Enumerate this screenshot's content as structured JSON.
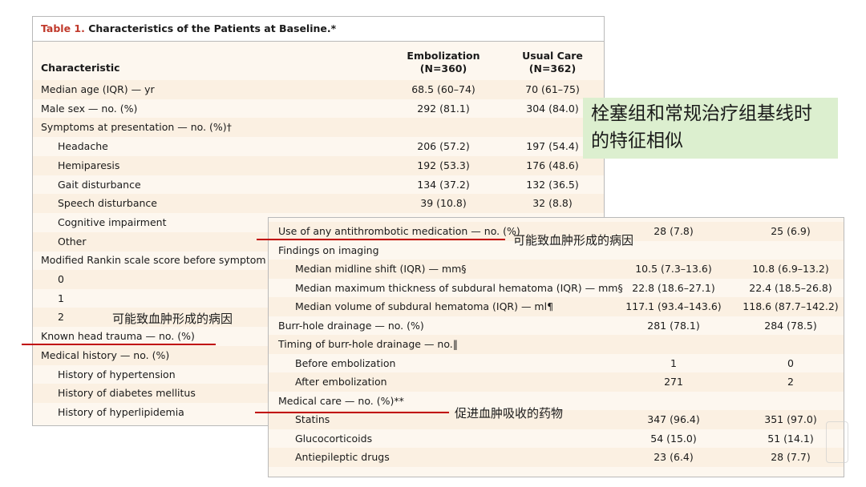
{
  "table1": {
    "title_prefix": "Table 1.",
    "title_rest": " Characteristics of the Patients at Baseline.*",
    "col_characteristic": "Characteristic",
    "col_embol": "Embolization",
    "col_embol_n": "(N=360)",
    "col_usual": "Usual Care",
    "col_usual_n": "(N=362)",
    "rows": [
      {
        "label": "Median age (IQR) — yr",
        "embol": "68.5 (60–74)",
        "usual": "70 (61–75)"
      },
      {
        "label": "Male sex — no. (%)",
        "embol": "292 (81.1)",
        "usual": "304 (84.0)"
      },
      {
        "label": "Symptoms at presentation — no. (%)†",
        "embol": "",
        "usual": ""
      },
      {
        "label": "Headache",
        "embol": "206 (57.2)",
        "usual": "197 (54.4)"
      },
      {
        "label": "Hemiparesis",
        "embol": "192 (53.3)",
        "usual": "176 (48.6)"
      },
      {
        "label": "Gait disturbance",
        "embol": "134 (37.2)",
        "usual": "132 (36.5)"
      },
      {
        "label": "Speech disturbance",
        "embol": "39 (10.8)",
        "usual": "32 (8.8)"
      },
      {
        "label": "Cognitive impairment",
        "embol": "",
        "usual": ""
      },
      {
        "label": "Other",
        "embol": "",
        "usual": ""
      },
      {
        "label": "Modified Rankin scale score before symptom",
        "embol": "",
        "usual": ""
      },
      {
        "label": "0",
        "embol": "",
        "usual": ""
      },
      {
        "label": "1",
        "embol": "",
        "usual": ""
      },
      {
        "label": "2",
        "embol": "",
        "usual": ""
      },
      {
        "label": "Known head trauma — no. (%)",
        "embol": "",
        "usual": ""
      },
      {
        "label": "Medical history — no. (%)",
        "embol": "",
        "usual": ""
      },
      {
        "label": "History of hypertension",
        "embol": "",
        "usual": ""
      },
      {
        "label": "History of diabetes mellitus",
        "embol": "",
        "usual": ""
      },
      {
        "label": "History of hyperlipidemia",
        "embol": "",
        "usual": ""
      }
    ]
  },
  "table2": {
    "rows": [
      {
        "label": "Use of any antithrombotic medication — no. (%)",
        "embol": "28 (7.8)",
        "usual": "25 (6.9)"
      },
      {
        "label": "Findings on imaging",
        "embol": "",
        "usual": ""
      },
      {
        "label": "Median midline shift (IQR) — mm§",
        "embol": "10.5 (7.3–13.6)",
        "usual": "10.8 (6.9–13.2)"
      },
      {
        "label": "Median maximum thickness of subdural hematoma (IQR) — mm§",
        "embol": "22.8 (18.6–27.1)",
        "usual": "22.4 (18.5–26.8)"
      },
      {
        "label": "Median volume of subdural hematoma (IQR) — ml¶",
        "embol": "117.1 (93.4–143.6)",
        "usual": "118.6 (87.7–142.2)"
      },
      {
        "label": "Burr-hole drainage — no. (%)",
        "embol": "281 (78.1)",
        "usual": "284 (78.5)"
      },
      {
        "label": "Timing of burr-hole drainage — no.‖",
        "embol": "",
        "usual": ""
      },
      {
        "label": "Before embolization",
        "embol": "1",
        "usual": "0"
      },
      {
        "label": "After embolization",
        "embol": "271",
        "usual": "2"
      },
      {
        "label": "Medical care — no. (%)**",
        "embol": "",
        "usual": ""
      },
      {
        "label": "Statins",
        "embol": "347 (96.4)",
        "usual": "351 (97.0)"
      },
      {
        "label": "Glucocorticoids",
        "embol": "54 (15.0)",
        "usual": "51 (14.1)"
      },
      {
        "label": "Antiepileptic drugs",
        "embol": "23 (6.4)",
        "usual": "28 (7.7)"
      }
    ]
  },
  "annotations": {
    "note_box": "栓塞组和常规治疗组基线时的特征相似",
    "cause_label_1": "可能致血肿形成的病因",
    "cause_label_2": "可能致血肿形成的病因",
    "drug_label": "促进血肿吸收的药物"
  },
  "colors": {
    "accent_red": "#c00000",
    "title_red": "#c0392b",
    "note_bg": "#dcefcf",
    "row_alt": "#fbf0e2"
  }
}
